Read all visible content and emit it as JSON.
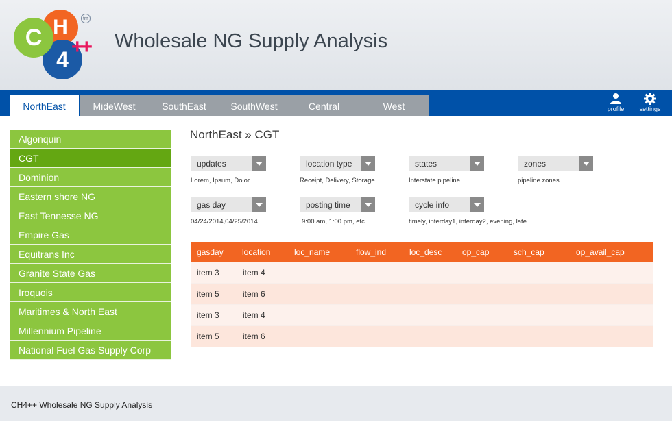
{
  "logo": {
    "c": "C",
    "h": "H",
    "four": "4",
    "plus": "++",
    "tm": "tm",
    "colors": {
      "green": "#8cc63f",
      "orange": "#f26522",
      "blue": "#1b5aa6",
      "pink": "#e8175d"
    }
  },
  "header": {
    "title": "Wholesale NG Supply Analysis"
  },
  "nav": {
    "tabs": [
      {
        "label": "NorthEast",
        "active": true
      },
      {
        "label": "MideWest"
      },
      {
        "label": "SouthEast"
      },
      {
        "label": "SouthWest"
      },
      {
        "label": "Central"
      },
      {
        "label": "West"
      }
    ],
    "profile": {
      "label": "profile",
      "icon": "person-icon"
    },
    "settings": {
      "label": "settings",
      "icon": "gear-icon"
    },
    "color": "#0051a8"
  },
  "sidebar": {
    "items": [
      {
        "label": "Algonquin"
      },
      {
        "label": "CGT",
        "active": true
      },
      {
        "label": "Dominion"
      },
      {
        "label": "Eastern shore NG"
      },
      {
        "label": "East Tennesse NG"
      },
      {
        "label": "Empire Gas"
      },
      {
        "label": "Equitrans Inc"
      },
      {
        "label": "Granite State Gas"
      },
      {
        "label": "Iroquois"
      },
      {
        "label": "Maritimes & North East"
      },
      {
        "label": "Millennium Pipeline"
      },
      {
        "label": "National Fuel Gas Supply Corp"
      }
    ]
  },
  "main": {
    "breadcrumb": "NorthEast » CGT",
    "filters": [
      {
        "label": "updates",
        "hint": "Lorem, Ipsum, Dolor"
      },
      {
        "label": "location type",
        "hint": "Receipt, Delivery, Storage"
      },
      {
        "label": "states",
        "hint": "Interstate pipeline"
      },
      {
        "label": "zones",
        "hint": "pipeline zones"
      },
      {
        "label": "gas day",
        "hint": "04/24/2014,04/25/2014"
      },
      {
        "label": "posting time",
        "hint": "9:00 am, 1:00 pm, etc"
      },
      {
        "label": "cycle info",
        "hint": "timely, interday1, interday2, evening, late"
      }
    ],
    "table": {
      "columns": [
        "gasday",
        "location",
        "loc_name",
        "flow_ind",
        "loc_desc",
        "op_cap",
        "sch_cap",
        "op_avail_cap"
      ],
      "rows": [
        [
          "item 3",
          "item 4"
        ],
        [
          "item 5",
          "item 6"
        ],
        [
          "item 3",
          "item 4"
        ],
        [
          "item 5",
          "item 6"
        ]
      ]
    }
  },
  "footer": {
    "text": "CH4++ Wholesale NG Supply Analysis"
  }
}
